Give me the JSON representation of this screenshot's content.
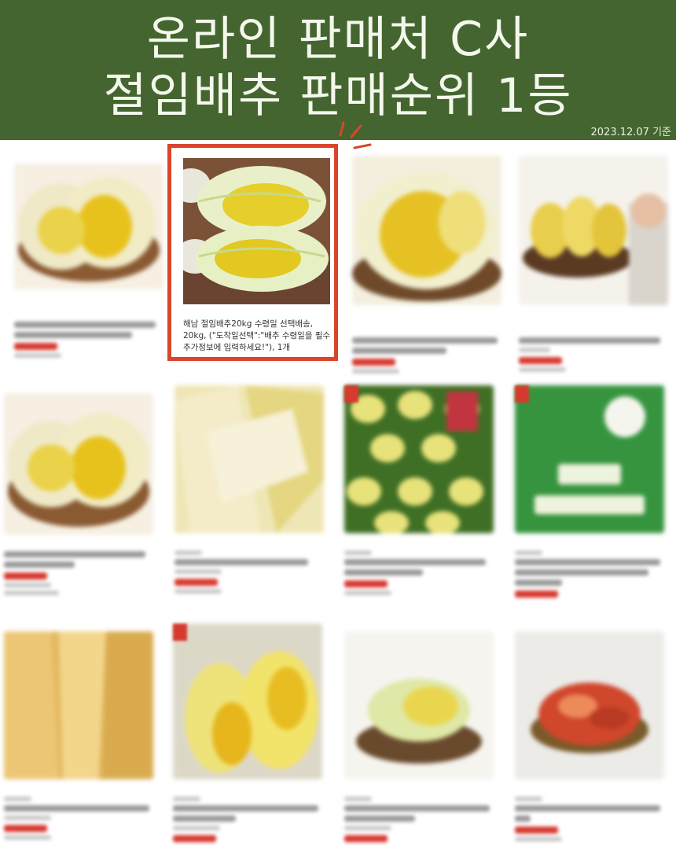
{
  "banner": {
    "line1": "온라인 판매처 C사",
    "line2": "절임배추 판매순위 1등",
    "basis": "2023.12.07 기준"
  },
  "highlight": {
    "title": "해남 절임배추20kg 수령일 선택배송, 20kg, (\"도착일선택\":\"배추 수령일을 필수추가정보에 입력하세요!\"), 1개"
  },
  "products": [
    {
      "id": "p1",
      "thumb": "cabbage-bowl"
    },
    {
      "id": "p3",
      "thumb": "cabbage-plate"
    },
    {
      "id": "p4",
      "thumb": "cabbage-grandma"
    },
    {
      "id": "p5",
      "thumb": "cabbage-bowl"
    },
    {
      "id": "p6",
      "thumb": "salted-leaves"
    },
    {
      "id": "p7",
      "thumb": "cabbage-field"
    },
    {
      "id": "p8",
      "thumb": "goesan-banner"
    },
    {
      "id": "p9",
      "thumb": "salted-leaves"
    },
    {
      "id": "p10",
      "thumb": "cabbage-closeup"
    },
    {
      "id": "p11",
      "thumb": "cabbage-plate"
    },
    {
      "id": "p12",
      "thumb": "kimchi"
    }
  ],
  "colors": {
    "banner": "#44652f",
    "highlight_border": "#d9462a",
    "price": "#d6392f"
  }
}
